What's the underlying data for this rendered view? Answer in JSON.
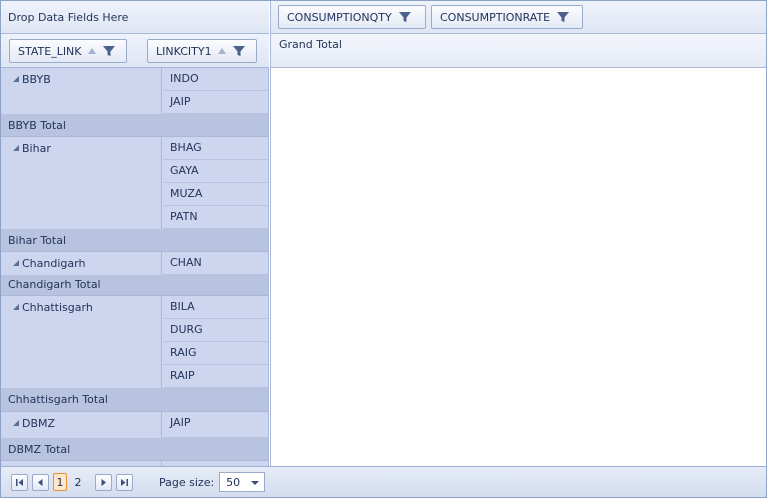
{
  "drop_area": {
    "label": "Drop Data Fields Here"
  },
  "column_fields": [
    {
      "label": "CONSUMPTIONQTY",
      "icon": "filter-icon"
    },
    {
      "label": "CONSUMPTIONRATE",
      "icon": "filter-icon"
    }
  ],
  "row_fields": [
    {
      "label": "STATE_LINK",
      "icon": "filter-icon"
    },
    {
      "label": "LINKCITY1",
      "icon": "filter-icon"
    }
  ],
  "grand_total_label": "Grand Total",
  "groups": [
    {
      "state": "BBYB",
      "cities": [
        "INDO",
        "JAIP"
      ],
      "total": "BBYB Total"
    },
    {
      "state": "Bihar",
      "cities": [
        "BHAG",
        "GAYA",
        "MUZA",
        "PATN"
      ],
      "total": "Bihar Total"
    },
    {
      "state": "Chandigarh",
      "cities": [
        "CHAN"
      ],
      "total": "Chandigarh Total"
    },
    {
      "state": "Chhattisgarh",
      "cities": [
        "BILA",
        "DURG",
        "RAIG",
        "RAIP"
      ],
      "total": "Chhattisgarh Total"
    },
    {
      "state": "DBMZ",
      "cities": [
        "JAIP"
      ],
      "total": "DBMZ Total"
    }
  ],
  "pager": {
    "pages": [
      "1",
      "2"
    ],
    "current_page": "1",
    "page_size_label": "Page size:",
    "page_size_value": "50"
  },
  "colors": {
    "header": "#dfe6f4",
    "row_cell": "#cdd6ee",
    "total_row": "#b8c4df",
    "accent": "#e0913a"
  }
}
